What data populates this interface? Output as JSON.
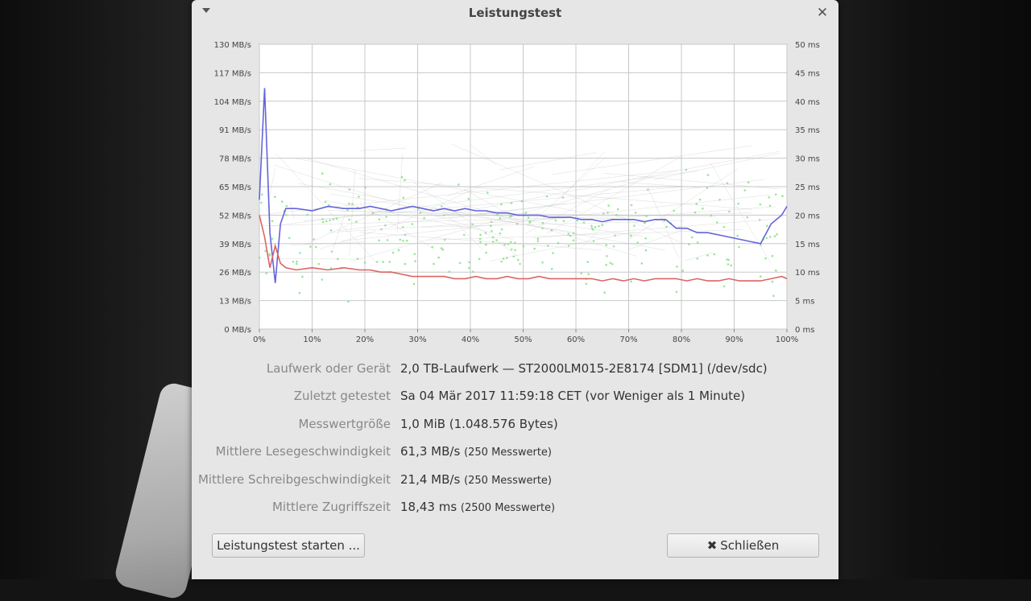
{
  "window": {
    "title": "Leistungstest",
    "close_glyph": "✕"
  },
  "chart_data": {
    "type": "line",
    "x_ticks": [
      "0%",
      "10%",
      "20%",
      "30%",
      "40%",
      "50%",
      "60%",
      "70%",
      "80%",
      "90%",
      "100%"
    ],
    "y_left_ticks": [
      "0 MB/s",
      "13 MB/s",
      "26 MB/s",
      "39 MB/s",
      "52 MB/s",
      "65 MB/s",
      "78 MB/s",
      "91 MB/s",
      "104 MB/s",
      "117 MB/s",
      "130 MB/s"
    ],
    "y_right_ticks": [
      "0 ms",
      "5 ms",
      "10 ms",
      "15 ms",
      "20 ms",
      "25 ms",
      "30 ms",
      "35 ms",
      "40 ms",
      "45 ms",
      "50 ms"
    ],
    "xlim": [
      0,
      100
    ],
    "ylim_left": [
      0,
      130
    ],
    "ylim_right": [
      0,
      50
    ],
    "grid": true,
    "series": [
      {
        "color": "#6464dc",
        "x": [
          0,
          1,
          2,
          3,
          4,
          5,
          7,
          10,
          13,
          16,
          19,
          21,
          23,
          25,
          27,
          29,
          31,
          33,
          35,
          37,
          39,
          41,
          43,
          45,
          47,
          49,
          51,
          53,
          55,
          57,
          59,
          61,
          63,
          65,
          67,
          69,
          71,
          73,
          75,
          77,
          79,
          81,
          83,
          85,
          87,
          89,
          91,
          93,
          95,
          97,
          99,
          100
        ],
        "values": [
          59,
          110,
          44,
          21,
          48,
          55,
          55,
          54,
          56,
          55,
          55,
          56,
          55,
          54,
          55,
          56,
          55,
          54,
          55,
          54,
          55,
          54,
          54,
          53,
          53,
          52,
          52,
          52,
          51,
          51,
          51,
          50,
          50,
          49,
          50,
          50,
          50,
          49,
          50,
          50,
          46,
          46,
          44,
          44,
          43,
          42,
          41,
          40,
          39,
          48,
          52,
          56
        ]
      },
      {
        "color": "#dc6464",
        "x": [
          0,
          1,
          2,
          3,
          4,
          5,
          7,
          10,
          13,
          16,
          19,
          21,
          23,
          25,
          27,
          29,
          31,
          33,
          35,
          37,
          39,
          41,
          43,
          45,
          47,
          49,
          51,
          53,
          55,
          57,
          59,
          61,
          63,
          65,
          67,
          69,
          71,
          73,
          75,
          77,
          79,
          81,
          83,
          85,
          87,
          89,
          91,
          93,
          95,
          97,
          99,
          100
        ],
        "values": [
          52,
          42,
          28,
          38,
          30,
          28,
          27,
          28,
          27,
          28,
          27,
          27,
          26,
          26,
          25,
          24,
          24,
          24,
          24,
          23,
          23,
          24,
          23,
          23,
          24,
          23,
          23,
          24,
          23,
          23,
          23,
          23,
          23,
          22,
          23,
          22,
          23,
          22,
          23,
          23,
          23,
          22,
          23,
          22,
          22,
          23,
          22,
          22,
          22,
          23,
          24,
          23
        ]
      }
    ]
  },
  "info": {
    "device_label": "Laufwerk oder Gerät",
    "device_value": "2,0 TB-Laufwerk — ST2000LM015-2E8174 [SDM1] (/dev/sdc)",
    "last_test_label": "Zuletzt getestet",
    "last_test_value": "Sa 04 Mär 2017 11:59:18 CET (vor Weniger als 1 Minute)",
    "sample_size_label": "Messwertgröße",
    "sample_size_value": "1,0 MiB (1.048.576 Bytes)",
    "read_label": "Mittlere Lesegeschwindigkeit",
    "read_value": "61,3 MB/s",
    "read_count": "(250 Messwerte)",
    "write_label": "Mittlere Schreibgeschwindigkeit",
    "write_value": "21,4 MB/s",
    "write_count": "(250 Messwerte)",
    "access_label": "Mittlere Zugriffszeit",
    "access_value": "18,43 ms",
    "access_count": "(2500 Messwerte)"
  },
  "buttons": {
    "start_label": "Leistungstest starten ...",
    "close_label": "Schließen",
    "close_icon": "✖"
  }
}
